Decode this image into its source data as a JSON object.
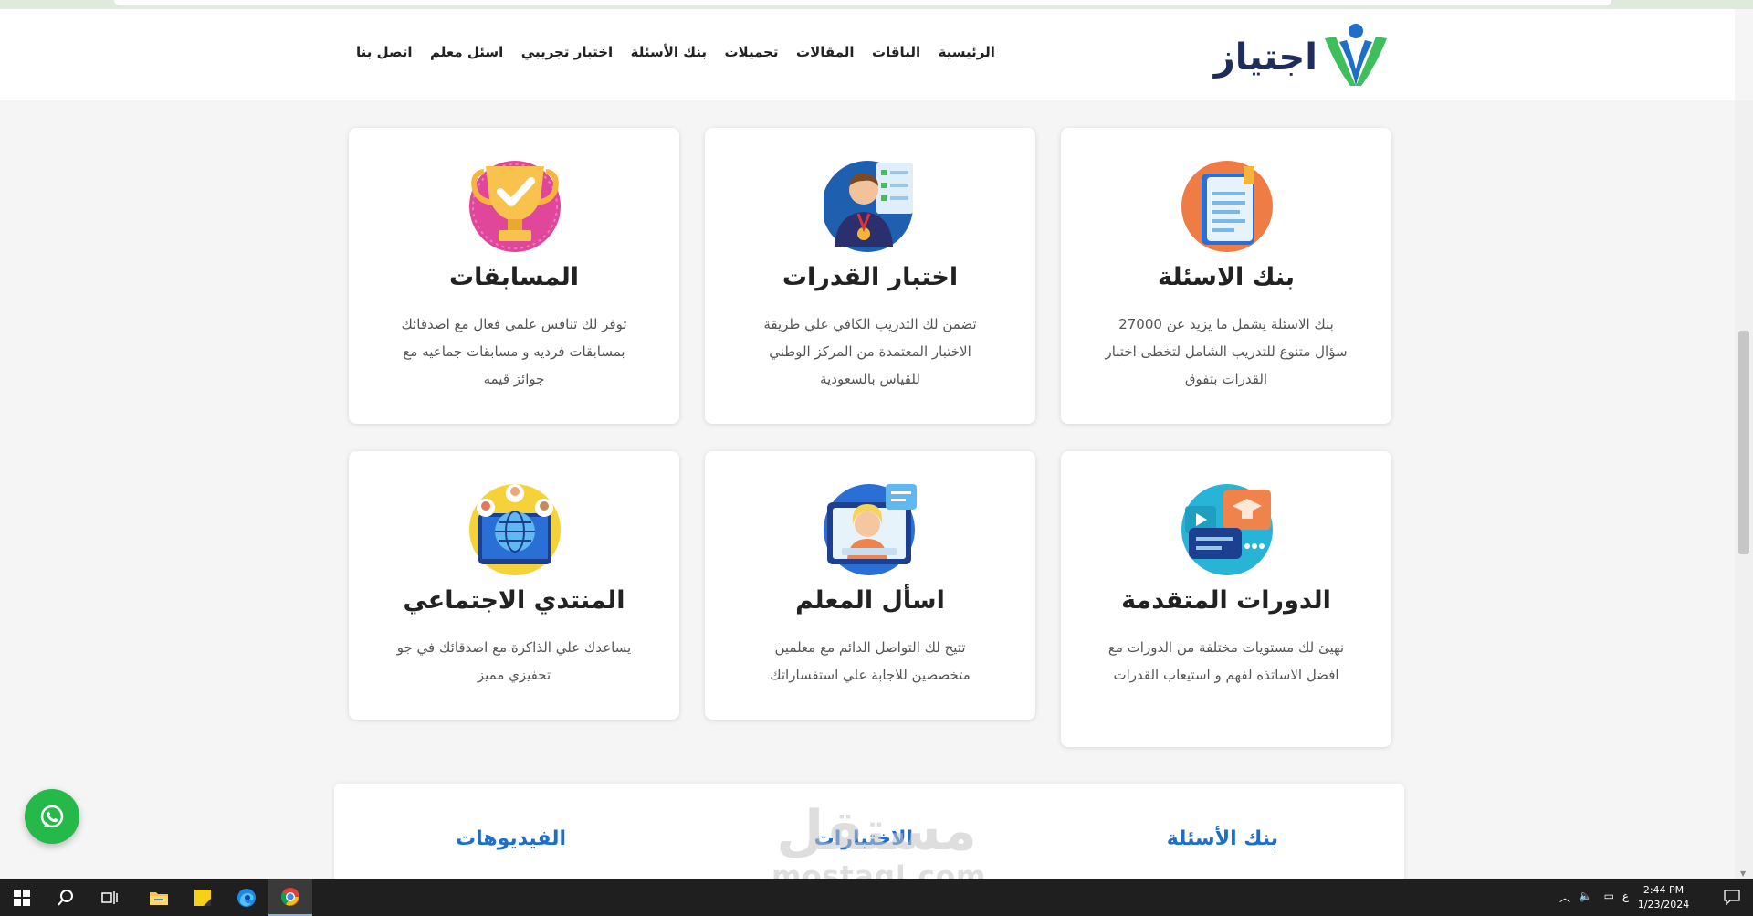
{
  "header": {
    "logo_text": "اجتياز",
    "nav": [
      "الرئيسية",
      "الباقات",
      "المقالات",
      "تحميلات",
      "بنك الأسئلة",
      "اختبار تجريبي",
      "اسئل معلم",
      "اتصل بنا"
    ]
  },
  "cards": [
    {
      "icon": "question-bank-book-icon",
      "title": "بنك الاسئلة",
      "desc": "بنك الاسئلة يشمل ما يزيد عن 27000 سؤال متنوع للتدريب الشامل لتخطى اختبار القدرات بتفوق"
    },
    {
      "icon": "aptitude-test-candidate-icon",
      "title": "اختبار القدرات",
      "desc": "تضمن لك التدريب الكافي علي طريقة الاختبار المعتمدة من المركز الوطني للقياس بالسعودية"
    },
    {
      "icon": "trophy-icon",
      "title": "المسابقات",
      "desc": "توفر لك تنافس علمي فعال مع اصدقائك بمسابقات فرديه و مسابقات جماعيه مع جوائز قيمه"
    },
    {
      "icon": "advanced-courses-icon",
      "title": "الدورات المتقدمة",
      "desc": "نهيئ لك مستويات مختلفة من الدورات مع افضل الاساتذه لفهم و استيعاب القدرات"
    },
    {
      "icon": "ask-teacher-icon",
      "title": "اسأل المعلم",
      "desc": "تتيح لك التواصل الدائم مع معلمين متخصصين للاجابة علي استفساراتك"
    },
    {
      "icon": "social-forum-globe-icon",
      "title": "المنتدي الاجتماعي",
      "desc": "يساعدك علي الذاكرة مع اصدقائك في جو تحفيزي مميز"
    }
  ],
  "tabs": [
    "بنك الأسئلة",
    "الاختبارات",
    "الفيديوهات"
  ],
  "watermark": {
    "arabic": "مستقل",
    "latin": "mostaql.com"
  },
  "taskbar": {
    "apps": [
      "windows-start-icon",
      "search-icon",
      "task-view-icon",
      "file-explorer-icon",
      "sticky-notes-icon",
      "edge-browser-icon",
      "chrome-browser-icon"
    ],
    "tray_lang": "ع",
    "time": "2:44 PM",
    "date": "1/23/2024"
  },
  "colors": {
    "brand_navy": "#1f2d5c",
    "brand_blue": "#1f6fc8",
    "brand_green": "#3fbf5c",
    "whatsapp": "#25b94a"
  }
}
